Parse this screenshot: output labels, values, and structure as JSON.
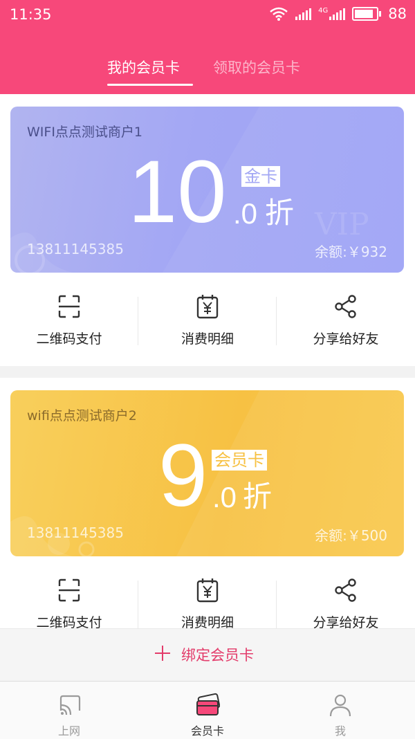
{
  "status_bar": {
    "time": "11:35",
    "network": "4G",
    "battery": "88"
  },
  "tabs": [
    {
      "label": "我的会员卡",
      "active": true
    },
    {
      "label": "领取的会员卡",
      "active": false
    }
  ],
  "cards": [
    {
      "merchant": "WIFI点点测试商户1",
      "discount_main": "10",
      "discount_decimal": ".0",
      "discount_unit": "折",
      "level": "金卡",
      "phone": "13811145385",
      "balance": "余额:￥932",
      "color": "#a3a7f4",
      "actions": [
        {
          "label": "二维码支付",
          "icon": "qr-scan-icon"
        },
        {
          "label": "消费明细",
          "icon": "receipt-yuan-icon"
        },
        {
          "label": "分享给好友",
          "icon": "share-icon"
        }
      ]
    },
    {
      "merchant": "wifi点点测试商户2",
      "discount_main": "9",
      "discount_decimal": ".0",
      "discount_unit": "折",
      "level": "会员卡",
      "phone": "13811145385",
      "balance": "余额:￥500",
      "color": "#f7c143",
      "actions": [
        {
          "label": "二维码支付",
          "icon": "qr-scan-icon"
        },
        {
          "label": "消费明细",
          "icon": "receipt-yuan-icon"
        },
        {
          "label": "分享给好友",
          "icon": "share-icon"
        }
      ]
    }
  ],
  "bind_card": {
    "label": "绑定会员卡",
    "icon": "plus-icon"
  },
  "bottom_nav": [
    {
      "label": "上网",
      "icon": "wifi-icon",
      "active": false
    },
    {
      "label": "会员卡",
      "icon": "card-icon",
      "active": true
    },
    {
      "label": "我",
      "icon": "person-icon",
      "active": false
    }
  ],
  "colors": {
    "header": "#f7487a",
    "accent": "#e33b6a"
  }
}
